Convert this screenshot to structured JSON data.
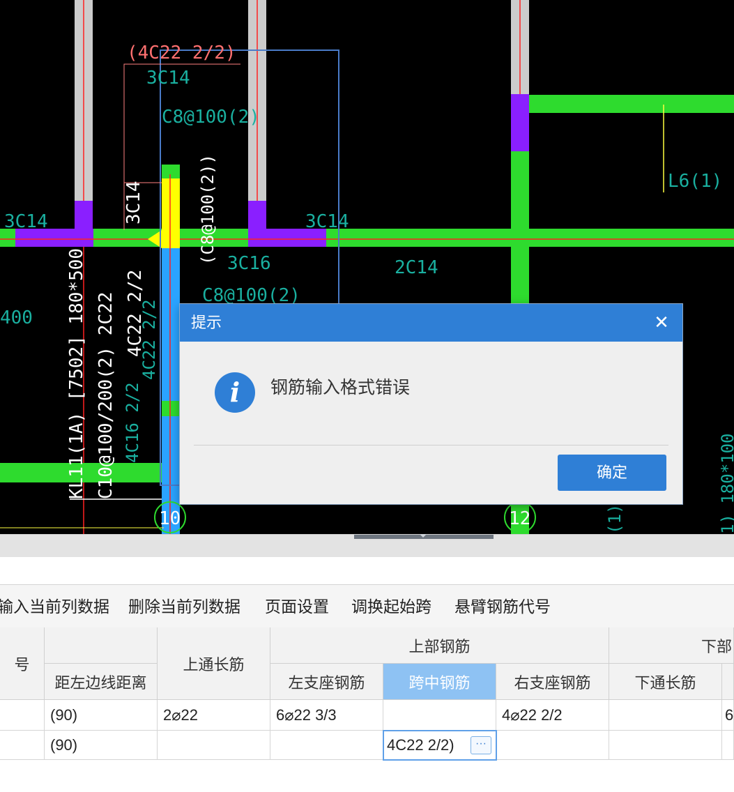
{
  "cad": {
    "labels": {
      "dim_4c22": "(4C22 2/2)",
      "top_3c14": "3C14",
      "stirrup_a": "C8@100(2)",
      "stirrup_vertical": "(C8@100(2))",
      "vert_3c14": "3C14",
      "left_3c14": "3C14",
      "mid_3c14": "3C14",
      "beam_3c16": "3C16",
      "beam_2c14": "2C14",
      "stirrup_b": "C8@100(2)",
      "l6": "L6(1)",
      "left_400": "400",
      "kl_line1": "KL11(1A) [7502] 180*500",
      "kl_line2": "C10@100/200(2) 2C22",
      "kl_line3": "4C22 2/2",
      "kl_line4": "4C22 2/2",
      "kl_line5": "4C16 2/2",
      "axis_10": "10",
      "axis_12": "12",
      "right_edge_1": "(1)",
      "right_edge_2": "1) 180*100"
    }
  },
  "dialog": {
    "title": "提示",
    "close_icon": "close-icon",
    "info_icon": "info-icon",
    "message": "钢筋输入格式错误",
    "ok_label": "确定"
  },
  "toolbar": {
    "items": [
      "输入当前列数据",
      "删除当前列数据",
      "页面设置",
      "调换起始跨",
      "悬臂钢筋代号"
    ]
  },
  "grid": {
    "headers": {
      "col0": "号",
      "dist_left": "距左边线距离",
      "top_through": "上通长筋",
      "group_top": "上部钢筋",
      "left_support": "左支座钢筋",
      "mid_span": "跨中钢筋",
      "right_support": "右支座钢筋",
      "group_bottom": "下部",
      "bottom_through": "下通长筋"
    },
    "rows": [
      {
        "dist": "(90)",
        "top_through": "2⌀22",
        "left_support": "6⌀22 3/3",
        "mid_span": "",
        "right_support": "4⌀22 2/2",
        "bottom_through": "",
        "extra": "6"
      },
      {
        "dist": "(90)",
        "top_through": "",
        "left_support": "",
        "mid_span": "4C22 2/2)",
        "right_support": "",
        "bottom_through": "",
        "extra": ""
      }
    ],
    "edit_button_icon": "ellipsis-icon"
  }
}
